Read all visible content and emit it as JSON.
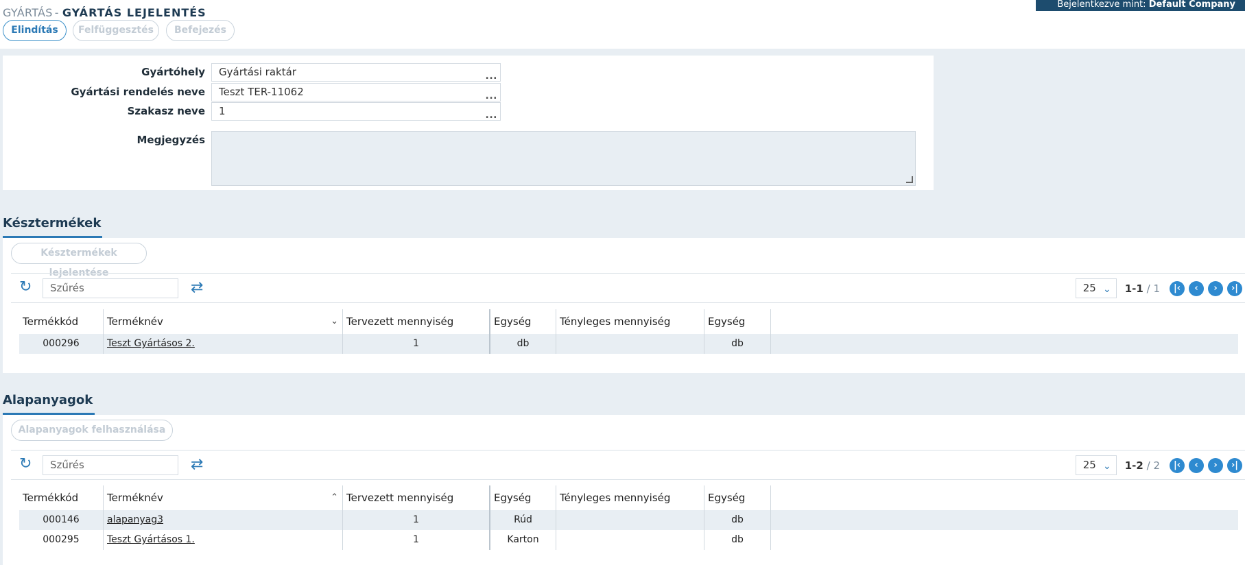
{
  "breadcrumb": {
    "parent": "GYÁRTÁS",
    "separator": "-",
    "current": "GYÁRTÁS LEJELENTÉS"
  },
  "user": {
    "prefix": "Bejelentkezve mint:",
    "name": "Default Company"
  },
  "actions": {
    "start": "Elindítás",
    "suspend": "Felfüggesztés",
    "finish": "Befejezés"
  },
  "form": {
    "site_label": "Gyártóhely",
    "site_value": "Gyártási raktár",
    "order_label": "Gyártási rendelés neve",
    "order_value": "Teszt TER-11062",
    "stage_label": "Szakasz neve",
    "stage_value": "1",
    "note_label": "Megjegyzés",
    "dots": "..."
  },
  "finished": {
    "title": "Késztermékek",
    "report_button": "Késztermékek lejelentése",
    "filter_placeholder": "Szűrés",
    "page_size": "25",
    "range": "1-1",
    "sep": "/",
    "total": "1",
    "columns": [
      "Termékkód",
      "Terméknév",
      "Tervezett mennyiség",
      "Egység",
      "Tényleges mennyiség",
      "Egység"
    ],
    "rows": [
      {
        "code": "000296",
        "name": "Teszt Gyártásos 2.",
        "planned": "1",
        "unit": "db",
        "actual": "",
        "unit2": "db"
      }
    ]
  },
  "materials": {
    "title": "Alapanyagok",
    "use_button": "Alapanyagok felhasználása",
    "filter_placeholder": "Szűrés",
    "page_size": "25",
    "range": "1-2",
    "sep": "/",
    "total": "2",
    "columns": [
      "Termékkód",
      "Terméknév",
      "Tervezett mennyiség",
      "Egység",
      "Tényleges mennyiség",
      "Egység"
    ],
    "rows": [
      {
        "code": "000146",
        "name": "alapanyag3",
        "planned": "1",
        "unit": "Rúd",
        "actual": "",
        "unit2": "db"
      },
      {
        "code": "000295",
        "name": "Teszt Gyártásos 1.",
        "planned": "1",
        "unit": "Karton",
        "actual": "",
        "unit2": "db"
      }
    ]
  }
}
